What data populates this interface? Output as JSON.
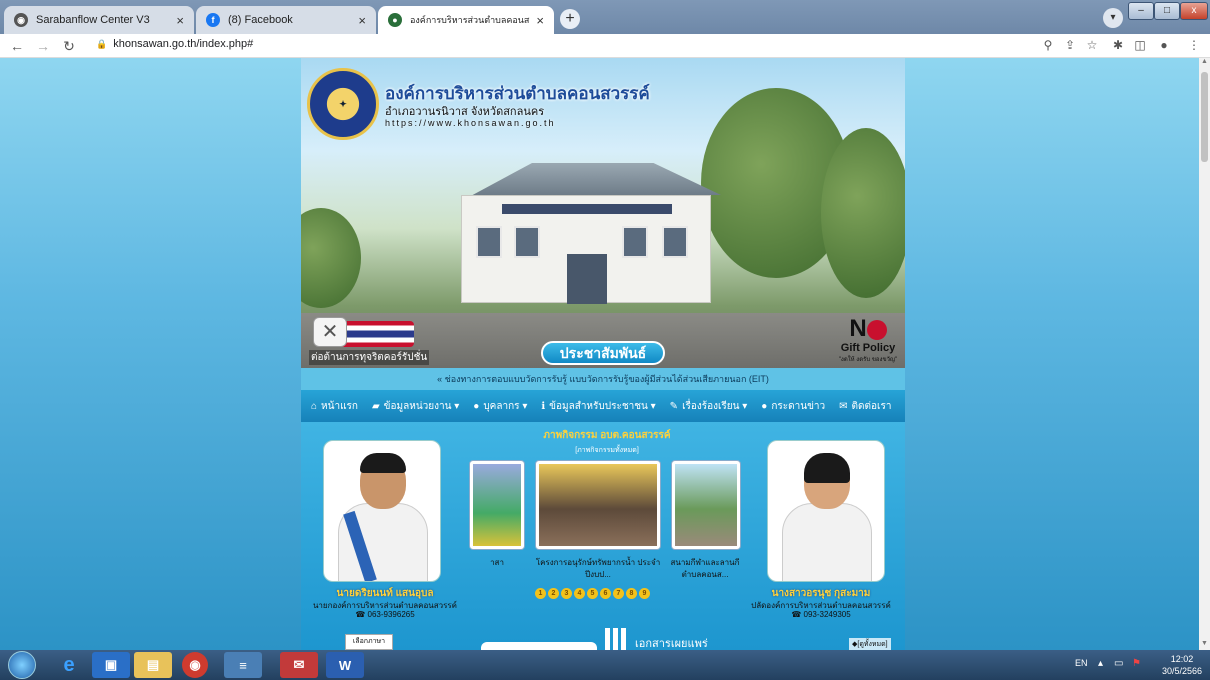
{
  "browser": {
    "tabs": [
      {
        "title": "Sarabanflow Center V3",
        "close": "×"
      },
      {
        "title": "(8) Facebook",
        "close": "×"
      },
      {
        "title": "องค์การบริหารส่วนตำบลคอนสวรรค์ (อ",
        "close": "×"
      }
    ],
    "new_tab": "+",
    "address": "khonsawan.go.th/index.php#",
    "window_buttons": {
      "minimize": "–",
      "maximize": "□",
      "close": "x"
    }
  },
  "site": {
    "org_name": "องค์การบริหารส่วนตำบลคอนสวรรค์",
    "district": "อำเภอวานรนิวาส จังหวัดสกลนคร",
    "url": "https://www.khonsawan.go.th",
    "anti_corruption": "ต่อต้านการทุจริตคอร์รัปชั่น",
    "gift_policy": {
      "title": "Gift Policy",
      "subtitle": "\"งดให้ งดรับ ของขวัญ\""
    },
    "pr_label": "ประชาสัมพันธ์",
    "eit_text": "« ช่องทางการตอบแบบวัดการรับรู้ แบบวัดการรับรู้ของผู้มีส่วนได้ส่วนเสียภายนอก (EIT)",
    "menu": [
      {
        "icon": "home-icon",
        "label": "หน้าแรก"
      },
      {
        "icon": "folder-icon",
        "label": "ข้อมูลหน่วยงาน ▾"
      },
      {
        "icon": "user-icon",
        "label": "บุคลากร ▾"
      },
      {
        "icon": "info-icon",
        "label": "ข้อมูลสำหรับประชาชน ▾"
      },
      {
        "icon": "edit-icon",
        "label": "เรื่องร้องเรียน ▾"
      },
      {
        "icon": "chat-icon",
        "label": "กระดานข่าว"
      },
      {
        "icon": "mail-icon",
        "label": "ติดต่อเรา"
      }
    ],
    "gallery": {
      "title": "ภาพกิจกรรม อบต.คอนสวรรค์",
      "all_link": "[ภาพกิจกรรมทั้งหมด]",
      "captions": [
        "าสา",
        "โครงการอนุรักษ์ทรัพยากรน้ำ ประจำปีงบป...",
        "สนามกีฬาและลานกี ตำบลคอนส..."
      ],
      "pages": [
        "1",
        "2",
        "3",
        "4",
        "5",
        "6",
        "7",
        "8",
        "9"
      ]
    },
    "left_person": {
      "name": "นายดริยนนท์ แสนอุบล",
      "title": "นายกองค์การบริหารส่วนตำบลคอนสวรรค์",
      "phone": "☎ 063-9396265"
    },
    "right_person": {
      "name": "นางสาวอรนุช กุสะมาม",
      "title": "ปลัดองค์การบริหารส่วนตำบลคอนสวรรค์",
      "phone": "☎ 093-3249305"
    },
    "lang_select": "เลือกภาษา",
    "docs_title": "เอกสารเผยแพร่",
    "all_docs": "◆[ดูทั้งหมด]"
  },
  "taskbar": {
    "lang": "EN",
    "time": "12:02",
    "date": "30/5/2566"
  }
}
